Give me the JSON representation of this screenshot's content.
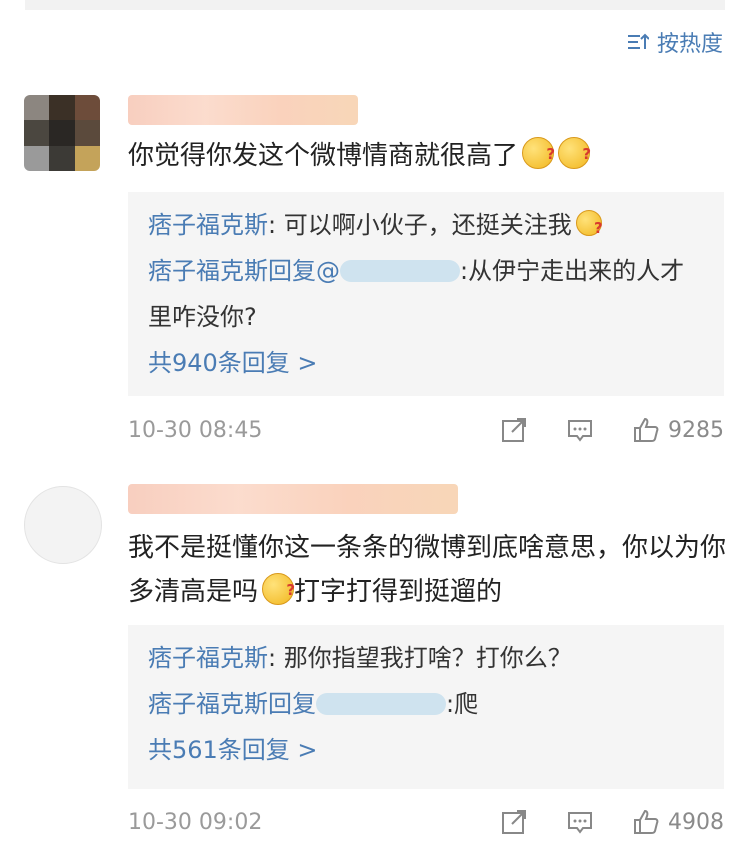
{
  "sort": {
    "label": "按热度",
    "icon": "sort-icon"
  },
  "comments": [
    {
      "text": "你觉得你发这个微博情商就很高了",
      "replies": [
        {
          "name": "痞子福克斯",
          "sep": ": ",
          "text": "可以啊小伙子，还挺关注我"
        },
        {
          "name": "痞子福克斯",
          "mid": "回复@",
          "text": ":从伊宁走出来的人才里咋没你?"
        }
      ],
      "more": "共940条回复 >",
      "time": "10-30 08:45",
      "likes": "9285"
    },
    {
      "text": "我不是挺懂你这一条条的微博到底啥意思，你以为你多清高是吗",
      "text2": "打字打得到挺遛的",
      "replies": [
        {
          "name": "痞子福克斯",
          "sep": ": ",
          "text": "那你指望我打啥？打你么？"
        },
        {
          "name": "痞子福克斯",
          "mid": "回复",
          "text": ":爬"
        }
      ],
      "more": "共561条回复 >",
      "time": "10-30 09:02",
      "likes": "4908"
    }
  ],
  "icons": [
    "share-icon",
    "comment-icon",
    "like-icon",
    "emoji-icon"
  ]
}
